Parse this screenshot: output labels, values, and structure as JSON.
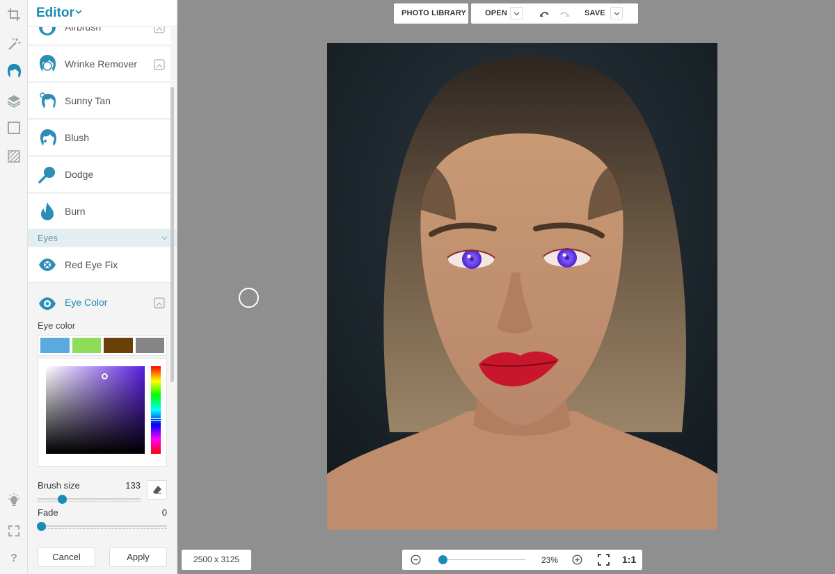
{
  "panel": {
    "title": "Editor",
    "tools": [
      {
        "label": "Airbrush"
      },
      {
        "label": "Wrinke Remover"
      },
      {
        "label": "Sunny Tan"
      },
      {
        "label": "Blush"
      },
      {
        "label": "Dodge"
      },
      {
        "label": "Burn"
      }
    ],
    "section": "Eyes",
    "eye_tools": [
      {
        "label": "Red Eye Fix"
      },
      {
        "label": "Eye Color"
      }
    ],
    "eye_color": {
      "sub_label": "Eye color",
      "swatches": [
        "#5aa9df",
        "#8fdc5b",
        "#6b4008",
        "#858585"
      ],
      "selected_color": "#5b1fe0",
      "brush_size_label": "Brush size",
      "brush_size_value": "133",
      "brush_size_fraction": 0.2,
      "fade_label": "Fade",
      "fade_value": "0",
      "fade_fraction": 0
    },
    "cancel": "Cancel",
    "apply": "Apply"
  },
  "toolbar": {
    "photo_library": "PHOTO LIBRARY",
    "open": "OPEN",
    "save": "SAVE"
  },
  "status": {
    "dimensions": "2500 x 3125",
    "zoom": "23%",
    "actual_size": "1:1"
  },
  "colors": {
    "accent": "#1c89b6",
    "workspace": "#8f8f8f"
  }
}
